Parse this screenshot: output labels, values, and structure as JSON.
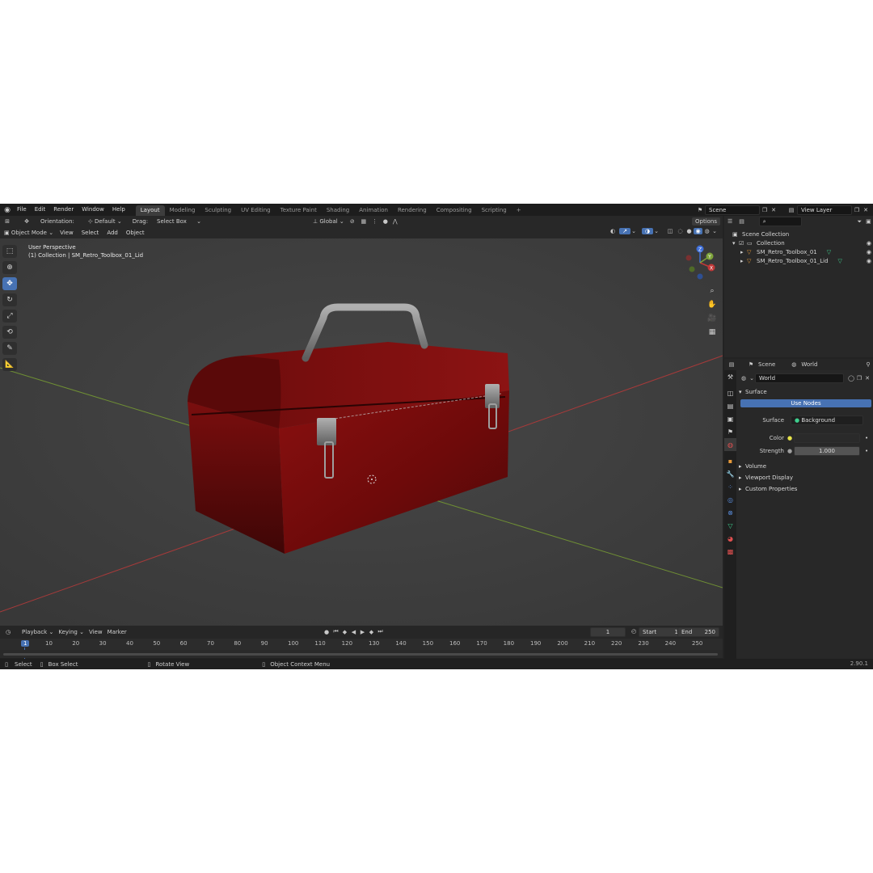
{
  "topbar": {
    "menus": [
      "File",
      "Edit",
      "Render",
      "Window",
      "Help"
    ],
    "workspaces": [
      "Layout",
      "Modeling",
      "Sculpting",
      "UV Editing",
      "Texture Paint",
      "Shading",
      "Animation",
      "Rendering",
      "Compositing",
      "Scripting"
    ],
    "active_workspace": "Layout",
    "add_tab": "+",
    "scene": "Scene",
    "view_layer": "View Layer"
  },
  "toolheader": {
    "orientation_label": "Orientation:",
    "orientation_value": "Default",
    "drag_label": "Drag:",
    "drag_value": "Select Box",
    "transform_orientation": "Global",
    "options": "Options"
  },
  "viewheader": {
    "mode": "Object Mode",
    "menus": [
      "View",
      "Select",
      "Add",
      "Object"
    ]
  },
  "viewport": {
    "perspective": "User Perspective",
    "collection_info": "(1) Collection | SM_Retro_Toolbox_01_Lid"
  },
  "gizmo": {
    "x": "X",
    "y": "Y",
    "z": "Z"
  },
  "timeline": {
    "menus": [
      "Playback",
      "Keying",
      "View",
      "Marker"
    ],
    "current_frame": "1",
    "start_label": "Start",
    "start_value": "1",
    "end_label": "End",
    "end_value": "250",
    "ticks": [
      "1",
      "10",
      "20",
      "30",
      "40",
      "50",
      "60",
      "70",
      "80",
      "90",
      "100",
      "110",
      "120",
      "130",
      "140",
      "150",
      "160",
      "170",
      "180",
      "190",
      "200",
      "210",
      "220",
      "230",
      "240",
      "250"
    ]
  },
  "statusbar": {
    "select": "Select",
    "box_select": "Box Select",
    "rotate_view": "Rotate View",
    "context_menu": "Object Context Menu",
    "version": "2.90.1"
  },
  "outliner": {
    "root": "Scene Collection",
    "collection": "Collection",
    "items": [
      "SM_Retro_Toolbox_01",
      "SM_Retro_Toolbox_01_Lid"
    ]
  },
  "properties": {
    "breadcrumb_scene": "Scene",
    "breadcrumb_world": "World",
    "world_name": "World",
    "surface_section": "Surface",
    "use_nodes": "Use Nodes",
    "surface_label": "Surface",
    "surface_value": "Background",
    "color_label": "Color",
    "strength_label": "Strength",
    "strength_value": "1.000",
    "sections": [
      "Volume",
      "Viewport Display",
      "Custom Properties"
    ]
  },
  "colors": {
    "accent": "#4772b3",
    "toolbox_red": "#7a0d0d",
    "x_axis": "#c03838",
    "y_axis": "#7ea33a",
    "background": "#3e3e3e"
  }
}
